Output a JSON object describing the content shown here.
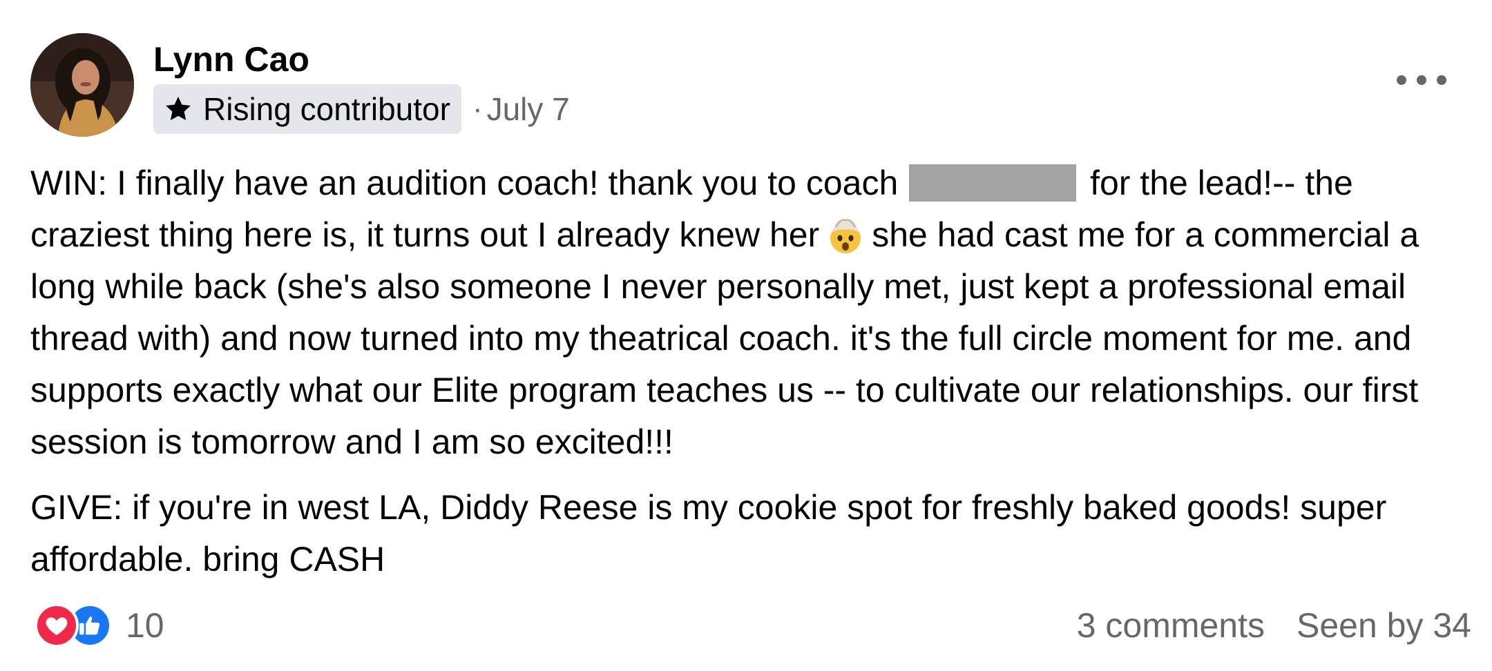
{
  "post": {
    "author": "Lynn Cao",
    "badge": {
      "icon": "star-icon",
      "label": "Rising contributor"
    },
    "separator": "·",
    "date": "July 7",
    "menu_icon": "more-options-icon",
    "body": {
      "para1": {
        "part1": "WIN: I finally have an audition coach! thank you to coach",
        "part2": "for the lead!-- the craziest thing here is, it turns out I already knew her",
        "emoji": "exploding-head-emoji",
        "part3": "she had cast me for a commercial a long while back (she's also someone I never personally met, just kept a professional email thread with) and now turned into my theatrical coach. it's the full circle moment for me. and supports exactly what our Elite program teaches us -- to cultivate our relationships. our first session is tomorrow and I am so excited!!!"
      },
      "para2": "GIVE: if you're in west LA, Diddy Reese is my cookie spot for freshly baked goods! super affordable. bring CASH"
    },
    "footer": {
      "reaction_icons": [
        "love-reaction-icon",
        "like-reaction-icon"
      ],
      "reaction_count": "10",
      "comments": "3 comments",
      "seen_by": "Seen by 34"
    },
    "colors": {
      "text": "#050505",
      "secondary_text": "#65676b",
      "badge_bg": "#e4e6eb",
      "love": "#f02849",
      "like": "#1877f2",
      "redaction": "#a3a3a3"
    }
  }
}
